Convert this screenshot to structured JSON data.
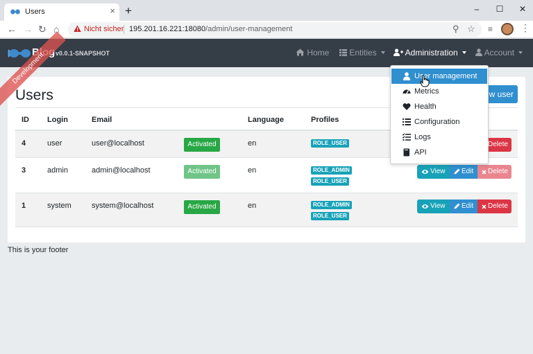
{
  "browser": {
    "tab_title": "Users",
    "new_tab": "+",
    "close_tab": "×",
    "not_secure_label": "Nicht sicher",
    "url_host": "195.201.16.221:18080",
    "url_path": "/admin/user-management"
  },
  "app": {
    "brand_title": "Blog",
    "brand_version": "v0.0.1-SNAPSHOT",
    "ribbon": "Development",
    "nav": {
      "home": "Home",
      "entities": "Entities",
      "administration": "Administration",
      "account": "Account"
    }
  },
  "admin_menu": {
    "items": [
      {
        "label": "User management",
        "icon": "user-icon",
        "active": true
      },
      {
        "label": "Metrics",
        "icon": "tachometer-icon"
      },
      {
        "label": "Health",
        "icon": "heart-icon"
      },
      {
        "label": "Configuration",
        "icon": "list-icon"
      },
      {
        "label": "Logs",
        "icon": "tasks-icon"
      },
      {
        "label": "API",
        "icon": "book-icon"
      }
    ]
  },
  "page": {
    "title": "Users",
    "create_button": "ew user",
    "columns": [
      "ID",
      "Login",
      "Email",
      "Language",
      "Profiles"
    ],
    "rows": [
      {
        "id": "4",
        "login": "user",
        "email": "user@localhost",
        "status": "Activated",
        "language": "en",
        "profiles": [
          "ROLE_USER"
        ]
      },
      {
        "id": "3",
        "login": "admin",
        "email": "admin@localhost",
        "status": "Activated",
        "language": "en",
        "profiles": [
          "ROLE_ADMIN",
          "ROLE_USER"
        ]
      },
      {
        "id": "1",
        "login": "system",
        "email": "system@localhost",
        "status": "Activated",
        "language": "en",
        "profiles": [
          "ROLE_ADMIN",
          "ROLE_USER"
        ]
      }
    ],
    "actions": {
      "view": "View",
      "edit": "Edit",
      "delete": "Delete"
    }
  },
  "footer": {
    "text": "This is your footer"
  },
  "colors": {
    "navbar": "#353d47",
    "primary": "#2f8fcf",
    "info": "#17a2b8",
    "success": "#28a745",
    "danger": "#dc3545"
  }
}
